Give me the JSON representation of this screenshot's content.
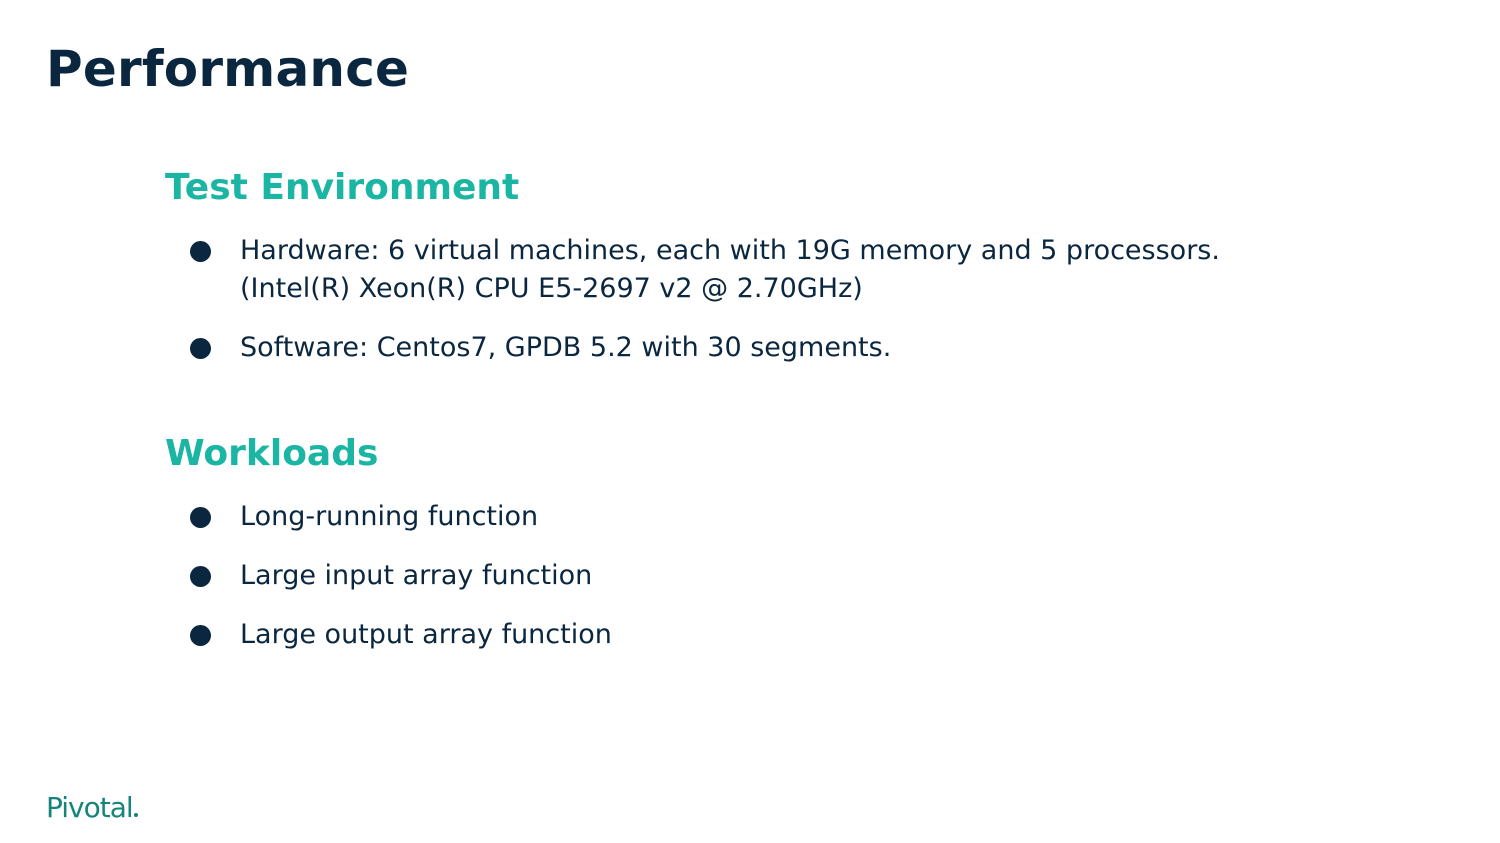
{
  "slide": {
    "title": "Performance",
    "sections": [
      {
        "heading": "Test Environment",
        "bullets": [
          {
            "line1": "Hardware: 6 virtual machines, each with 19G memory and 5 processors.",
            "line2": "(Intel(R) Xeon(R) CPU E5-2697 v2 @ 2.70GHz)"
          },
          {
            "line1": "Software: Centos7, GPDB 5.2 with 30 segments."
          }
        ]
      },
      {
        "heading": "Workloads",
        "bullets": [
          {
            "line1": "Long-running function"
          },
          {
            "line1": "Large input array function"
          },
          {
            "line1": "Large output array function"
          }
        ]
      }
    ],
    "logo": "Pivotal"
  },
  "colors": {
    "title": "#0b2740",
    "heading_accent": "#1ab5a3",
    "body_text": "#0b2740",
    "logo": "#15847a",
    "background": "#ffffff"
  }
}
